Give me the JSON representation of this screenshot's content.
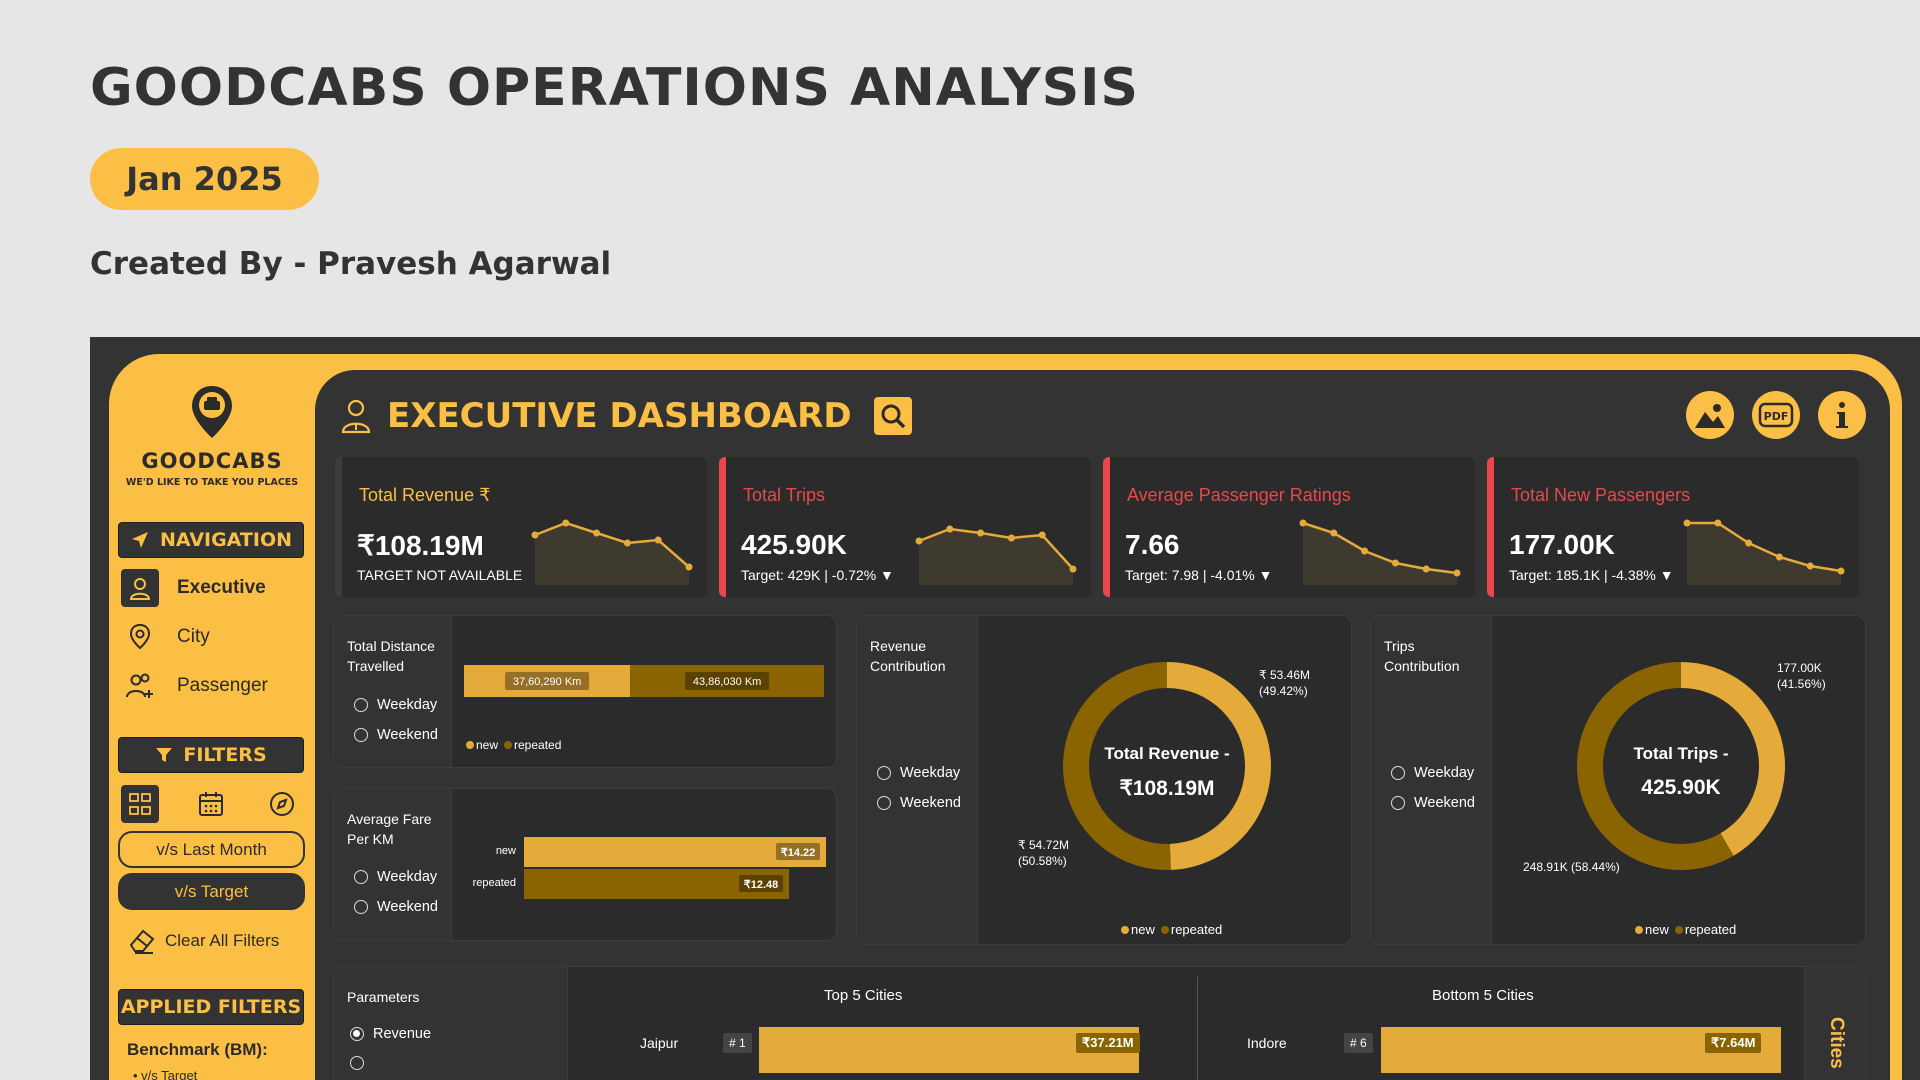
{
  "header": {
    "title": "GOODCABS OPERATIONS ANALYSIS",
    "month": "Jan 2025",
    "created_by": "Created By - Pravesh Agarwal"
  },
  "colors": {
    "accent": "#fbbf45",
    "dark": "#333333",
    "panel": "#2b2b2b",
    "alert": "#e8484b",
    "new_series": "#e5ab3a",
    "repeated_series": "#8a6400"
  },
  "sidebar": {
    "logo_text": "GOODCABS",
    "logo_tagline": "WE'D LIKE TO TAKE YOU PLACES",
    "navigation_header": "NAVIGATION",
    "nav_items": [
      {
        "label": "Executive",
        "icon": "person-icon",
        "active": true
      },
      {
        "label": "City",
        "icon": "location-pin-icon",
        "active": false
      },
      {
        "label": "Passenger",
        "icon": "people-add-icon",
        "active": false
      }
    ],
    "filters_header": "FILTERS",
    "filter_icons": [
      "city-type-icon",
      "calendar-icon",
      "compass-icon"
    ],
    "vs_last_month": "v/s Last Month",
    "vs_target": "v/s Target",
    "clear_filters": "Clear All Filters",
    "applied_filters_header": "APPLIED FILTERS",
    "benchmark_label": "Benchmark (BM):",
    "benchmark_value": "• v/s Target"
  },
  "dashboard": {
    "title": "EXECUTIVE DASHBOARD",
    "toolbar_icons": [
      "image-icon",
      "pdf-icon",
      "info-icon"
    ]
  },
  "kpis": [
    {
      "title": "Total Revenue ₹",
      "value": "₹108.19M",
      "subtitle": "TARGET NOT AVAILABLE",
      "status": "neutral",
      "trend": [
        46,
        58,
        48,
        38,
        41,
        14
      ]
    },
    {
      "title": "Total Trips",
      "value": "425.90K",
      "subtitle": "Target: 429K | -0.72% ▼",
      "status": "down",
      "trend": [
        40,
        52,
        48,
        43,
        46,
        12
      ]
    },
    {
      "title": "Average Passenger Ratings",
      "value": "7.66",
      "subtitle": "Target: 7.98 | -4.01% ▼",
      "status": "down",
      "trend": [
        58,
        48,
        30,
        18,
        12,
        8
      ]
    },
    {
      "title": "Total New Passengers",
      "value": "177.00K",
      "subtitle": "Target: 185.1K | -4.38% ▼",
      "status": "down",
      "trend": [
        58,
        58,
        38,
        24,
        15,
        10
      ]
    }
  ],
  "distance": {
    "label": "Total Distance Travelled",
    "options": [
      "Weekday",
      "Weekend"
    ],
    "new_label": "37,60,290 Km",
    "repeated_label": "43,86,030 Km",
    "legend": [
      "new",
      "repeated"
    ]
  },
  "fare": {
    "label": "Average Fare Per KM",
    "options": [
      "Weekday",
      "Weekend"
    ],
    "rows": [
      {
        "name": "new",
        "value": 14.22,
        "display": "₹14.22"
      },
      {
        "name": "repeated",
        "value": 12.48,
        "display": "₹12.48"
      }
    ]
  },
  "revenue_contribution": {
    "label": "Revenue Contribution",
    "options": [
      "Weekday",
      "Weekend"
    ],
    "center_title": "Total Revenue -",
    "center_value": "₹108.19M",
    "new_label": "₹ 53.46M",
    "new_pct": "(49.42%)",
    "repeated_label": "₹ 54.72M",
    "repeated_pct": "(50.58%)",
    "legend": [
      "new",
      "repeated"
    ]
  },
  "trips_contribution": {
    "label": "Trips Contribution",
    "options": [
      "Weekday",
      "Weekend"
    ],
    "center_title": "Total Trips -",
    "center_value": "425.90K",
    "new_label": "177.00K",
    "new_pct": "(41.56%)",
    "repeated_label": "248.91K (58.44%)",
    "legend": [
      "new",
      "repeated"
    ]
  },
  "parameters": {
    "label": "Parameters",
    "options": [
      "Revenue"
    ]
  },
  "top_cities": {
    "title": "Top 5 Cities",
    "rows": [
      {
        "city": "Jaipur",
        "rank": "# 1",
        "value": "₹37.21M"
      }
    ]
  },
  "bottom_cities": {
    "title": "Bottom 5 Cities",
    "rows": [
      {
        "city": "Indore",
        "rank": "# 6",
        "value": "₹7.64M"
      }
    ]
  },
  "cities_tab": "Cities",
  "chart_data": [
    {
      "type": "bar",
      "title": "Total Distance Travelled",
      "categories": [
        "new",
        "repeated"
      ],
      "values": [
        3760290,
        4386030
      ],
      "unit": "Km"
    },
    {
      "type": "bar",
      "title": "Average Fare Per KM",
      "categories": [
        "new",
        "repeated"
      ],
      "values": [
        14.22,
        12.48
      ]
    },
    {
      "type": "pie",
      "title": "Revenue Contribution",
      "categories": [
        "new",
        "repeated"
      ],
      "values": [
        53.46,
        54.72
      ],
      "percent": [
        49.42,
        50.58
      ]
    },
    {
      "type": "pie",
      "title": "Trips Contribution",
      "categories": [
        "new",
        "repeated"
      ],
      "values": [
        177.0,
        248.91
      ],
      "percent": [
        41.56,
        58.44
      ]
    },
    {
      "type": "bar",
      "title": "Top 5 Cities",
      "categories": [
        "Jaipur"
      ],
      "values": [
        37.21
      ]
    },
    {
      "type": "bar",
      "title": "Bottom 5 Cities",
      "categories": [
        "Indore"
      ],
      "values": [
        7.64
      ]
    }
  ]
}
